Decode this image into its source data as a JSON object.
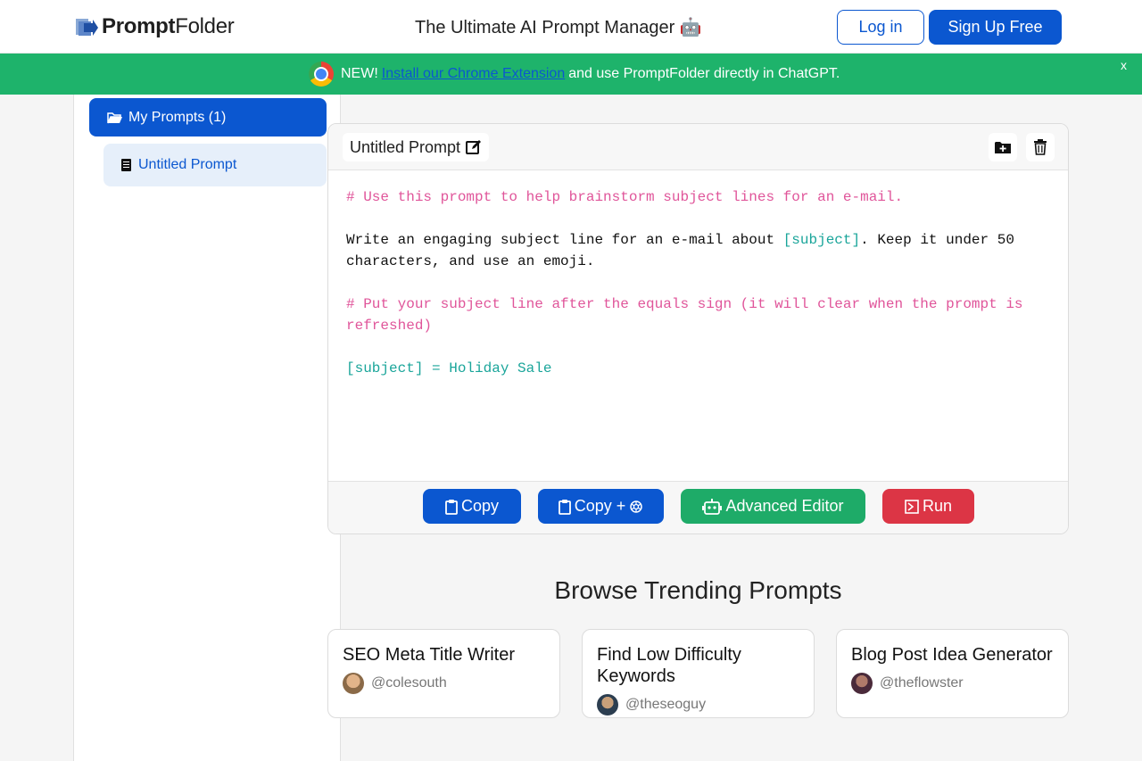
{
  "header": {
    "logo_bold": "Prompt",
    "logo_light": "Folder",
    "tagline": "The Ultimate AI Prompt Manager 🤖",
    "login_label": "Log in",
    "signup_label": "Sign Up Free"
  },
  "banner": {
    "new_text": "NEW!",
    "link_text": "Install our Chrome Extension",
    "rest_text": "and use PromptFolder directly in ChatGPT.",
    "close_label": "x"
  },
  "sidebar": {
    "folder_label": "My Prompts (1)",
    "items": [
      {
        "label": "Untitled Prompt"
      }
    ]
  },
  "editor": {
    "title": "Untitled Prompt",
    "lines": {
      "l1": "# Use this prompt to help brainstorm subject lines for an e-mail.",
      "l3a": "Write an engaging subject line for an e-mail about ",
      "l3var": "[subject]",
      "l3b": ". Keep it under 50 characters, and use an emoji.",
      "l5": "# Put your subject line after the equals sign (it will clear when the prompt is refreshed)",
      "l7": "[subject] = Holiday Sale"
    },
    "actions": {
      "copy": "Copy",
      "copy_plus": "Copy +",
      "advanced": "Advanced Editor",
      "run": "Run"
    }
  },
  "trending": {
    "heading": "Browse Trending Prompts",
    "cards": [
      {
        "title": "SEO Meta Title Writer",
        "author": "@colesouth"
      },
      {
        "title": "Find Low Difficulty Keywords",
        "author": "@theseoguy"
      },
      {
        "title": "Blog Post Idea Generator",
        "author": "@theflowster"
      }
    ]
  },
  "colors": {
    "primary": "#0b57d0",
    "banner_green": "#1eb36b",
    "advanced_green": "#1eab68",
    "run_red": "#dc3545",
    "comment_pink": "#e0559a",
    "variable_teal": "#1aa59a"
  }
}
